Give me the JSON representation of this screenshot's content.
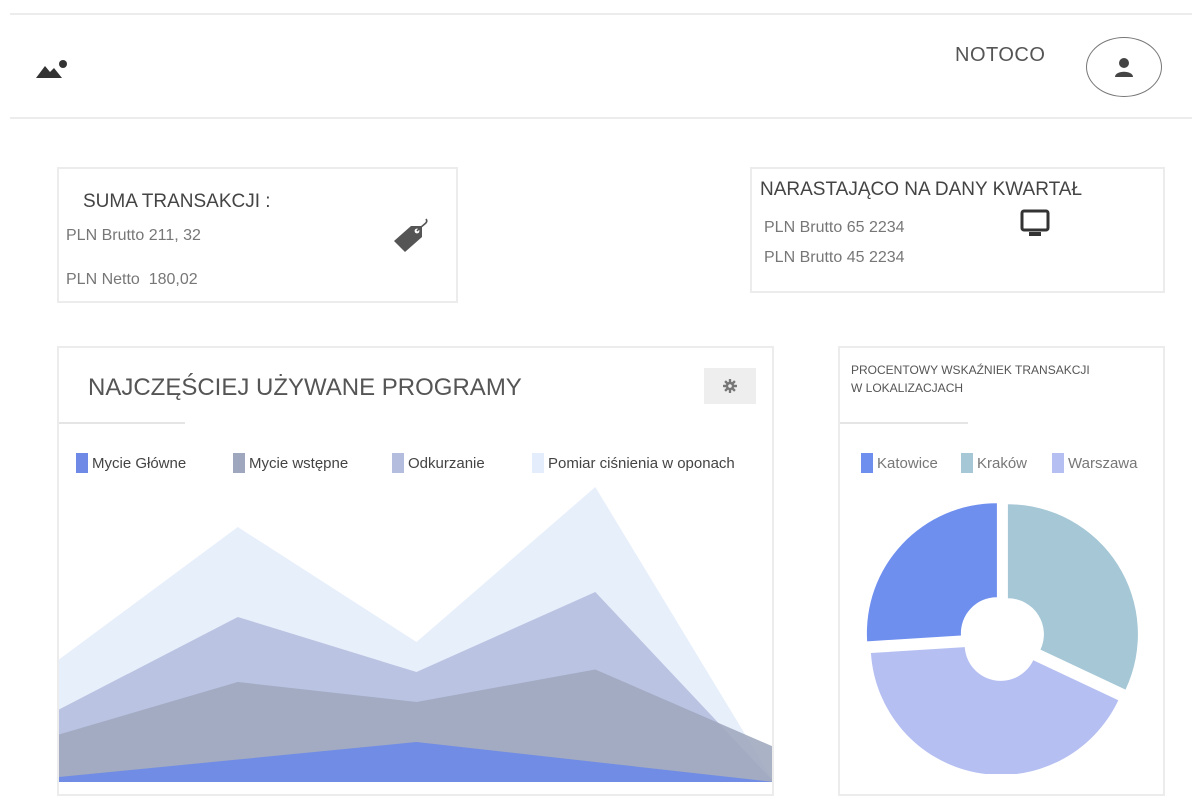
{
  "header": {
    "brand": "NOTOCO",
    "logo_icon": "mountain-image-icon",
    "user_icon": "user-icon"
  },
  "summary": {
    "title": "SUMA TRANSAKCJI :",
    "gross": "PLN Brutto 211, 32",
    "net": "PLN Netto  180,02",
    "icon": "tag-icon"
  },
  "quarter": {
    "title": "NARASTAJĄCO NA DANY KWARTAŁ",
    "line1": "PLN Brutto 65 2234",
    "line2": "PLN Brutto 45 2234",
    "icon": "monitor-icon"
  },
  "programs": {
    "title": "NAJCZĘŚCIEJ UŻYWANE PROGRAMY",
    "settings_icon": "gear-icon"
  },
  "locations": {
    "title_line1": "PROCENTOWY WSKAŹNIEK TRANSAKCJI",
    "title_line2": "W LOKALIZACJACH"
  },
  "chart_data": [
    {
      "type": "area",
      "title": "NAJCZĘŚCIEJ UŻYWANE PROGRAMY",
      "x": [
        0,
        1,
        2,
        3,
        4
      ],
      "series": [
        {
          "name": "Mycie Główne",
          "color": "#6f8ae6",
          "values": [
            0.2,
            0.9,
            1.6,
            0.8,
            0.0
          ]
        },
        {
          "name": "Mycie wstępne",
          "color": "#9ea7bd",
          "values": [
            1.9,
            4.0,
            3.2,
            4.5,
            1.4
          ]
        },
        {
          "name": "Odkurzanie",
          "color": "#b4bddd",
          "values": [
            2.9,
            6.6,
            4.4,
            7.6,
            0.0
          ]
        },
        {
          "name": "Pomiar ciśnienia w oponach",
          "color": "#e4edfb",
          "values": [
            4.9,
            10.2,
            5.6,
            11.8,
            0.0
          ]
        }
      ]
    },
    {
      "type": "pie",
      "title": "PROCENTOWY WSKAŹNIEK TRANSAKCJI W LOKALIZACJACH",
      "categories": [
        "Katowice",
        "Kraków",
        "Warszawa"
      ],
      "values": [
        26,
        32,
        42
      ],
      "colors": [
        "#6f8fef",
        "#a5c7d6",
        "#b5bff2"
      ]
    }
  ]
}
